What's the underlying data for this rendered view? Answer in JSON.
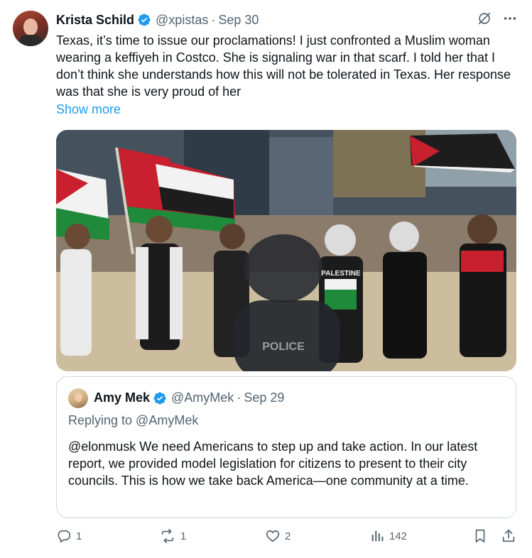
{
  "tweet": {
    "author_name": "Krista Schild",
    "handle": "@xpistas",
    "separator": "·",
    "date": "Sep 30",
    "text": "Texas, it’s time to issue our proclamations! I just confronted a Muslim woman wearing a keffiyeh in Costco. She is signaling war in that scarf. I told her that I don’t think she understands how this will not be tolerated in Texas. Her response was that she is very proud of her",
    "show_more": "Show more",
    "verified": true
  },
  "icons": {
    "grok": "grok-icon",
    "more": "more-options-icon",
    "verified": "verified-badge-icon"
  },
  "photo_text": {
    "shirt_print": "PALESTINE",
    "vest_print": "POLICE"
  },
  "quoted_tweet": {
    "author_name": "Amy Mek",
    "handle": "@AmyMek",
    "separator": "·",
    "date": "Sep 29",
    "replying_to": "Replying to @AmyMek",
    "text": "@elonmusk We need Americans to step up and take action. In our latest report, we provided model legislation for citizens to present to their city councils. This is how we take back America—one community at a time.",
    "verified": true
  },
  "actions": {
    "reply_count": "1",
    "retweet_count": "1",
    "like_count": "2",
    "views_count": "142"
  },
  "colors": {
    "link": "#1d9bf0",
    "secondary_text": "#536471",
    "primary_text": "#0f1419",
    "border": "#cfd9de",
    "flag_red": "#c8202e",
    "flag_green": "#1f8a3a"
  }
}
